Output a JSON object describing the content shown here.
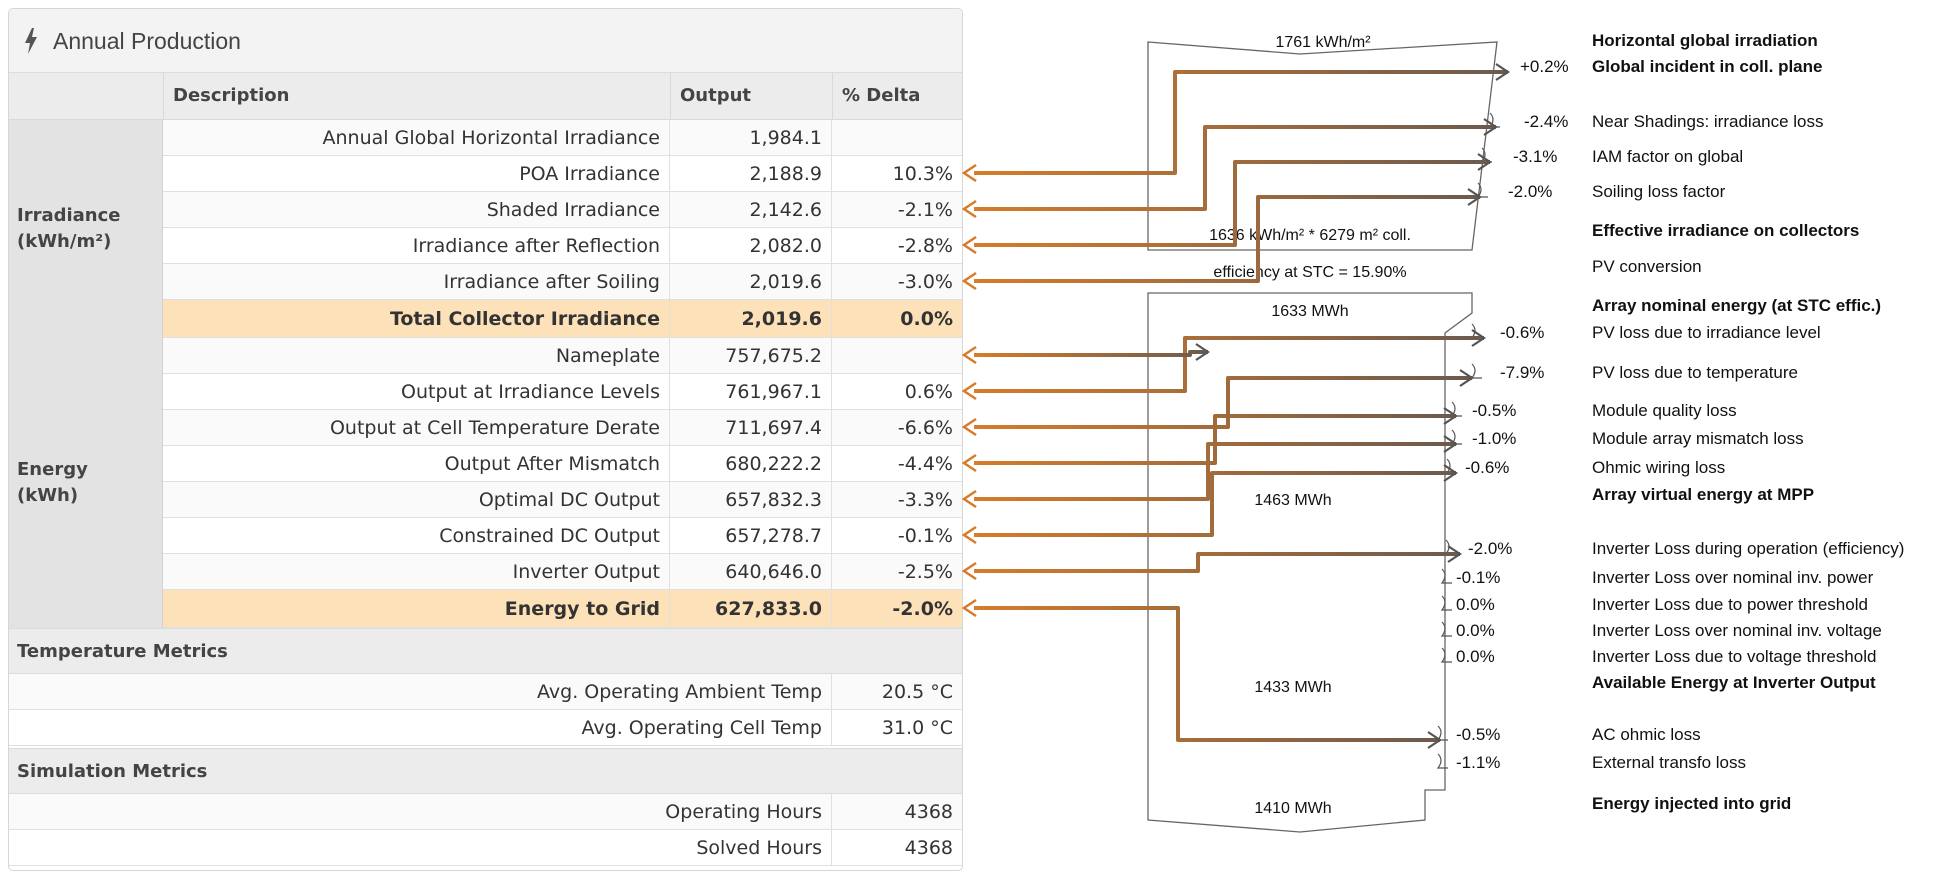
{
  "panel": {
    "title": "Annual Production"
  },
  "icons": {
    "title_icon": "lightning-bolt-icon",
    "arrow_icon": "left-arrow-icon"
  },
  "colors": {
    "accent_orange": "#d67c2a",
    "total_row_bg": "#fde1b8",
    "arrow_brown": "#6b5a4e"
  },
  "table": {
    "headers": {
      "description": "Description",
      "output": "Output",
      "delta": "% Delta"
    },
    "groups": [
      {
        "category": "Irradiance\n(kWh/m²)",
        "rows": [
          {
            "description": "Annual Global Horizontal Irradiance",
            "output": "1,984.1",
            "delta": "",
            "total": false
          },
          {
            "description": "POA Irradiance",
            "output": "2,188.9",
            "delta": "10.3%",
            "total": false
          },
          {
            "description": "Shaded Irradiance",
            "output": "2,142.6",
            "delta": "-2.1%",
            "total": false
          },
          {
            "description": "Irradiance after Reflection",
            "output": "2,082.0",
            "delta": "-2.8%",
            "total": false
          },
          {
            "description": "Irradiance after Soiling",
            "output": "2,019.6",
            "delta": "-3.0%",
            "total": false
          },
          {
            "description": "Total Collector Irradiance",
            "output": "2,019.6",
            "delta": "0.0%",
            "total": true
          }
        ]
      },
      {
        "category": "Energy\n(kWh)",
        "rows": [
          {
            "description": "Nameplate",
            "output": "757,675.2",
            "delta": "",
            "total": false
          },
          {
            "description": "Output at Irradiance Levels",
            "output": "761,967.1",
            "delta": "0.6%",
            "total": false
          },
          {
            "description": "Output at Cell Temperature Derate",
            "output": "711,697.4",
            "delta": "-6.6%",
            "total": false
          },
          {
            "description": "Output After Mismatch",
            "output": "680,222.2",
            "delta": "-4.4%",
            "total": false
          },
          {
            "description": "Optimal DC Output",
            "output": "657,832.3",
            "delta": "-3.3%",
            "total": false
          },
          {
            "description": "Constrained DC Output",
            "output": "657,278.7",
            "delta": "-0.1%",
            "total": false
          },
          {
            "description": "Inverter Output",
            "output": "640,646.0",
            "delta": "-2.5%",
            "total": false
          },
          {
            "description": "Energy to Grid",
            "output": "627,833.0",
            "delta": "-2.0%",
            "total": true
          }
        ]
      }
    ],
    "temperature_metrics": {
      "title": "Temperature Metrics",
      "rows": [
        {
          "label": "Avg. Operating Ambient Temp",
          "value": "20.5 °C"
        },
        {
          "label": "Avg. Operating Cell Temp",
          "value": "31.0 °C"
        }
      ]
    },
    "simulation_metrics": {
      "title": "Simulation Metrics",
      "rows": [
        {
          "label": "Operating Hours",
          "value": "4368"
        },
        {
          "label": "Solved Hours",
          "value": "4368"
        }
      ]
    }
  },
  "loss_diagram": {
    "box_texts": {
      "ghi": "1761 kWh/m²",
      "collector": "1636 kWh/m² * 6279 m² coll.",
      "efficiency": "efficiency at STC = 15.90%",
      "nominal": "1633 MWh",
      "mpp": "1463 MWh",
      "inverter": "1433 MWh",
      "grid": "1410 MWh"
    },
    "steps": [
      {
        "pct": "",
        "label": "Horizontal global irradiation",
        "bold": true
      },
      {
        "pct": "+0.2%",
        "label": "Global incident in coll. plane",
        "bold": true
      },
      {
        "pct": "-2.4%",
        "label": "Near Shadings: irradiance loss",
        "bold": false
      },
      {
        "pct": "-3.1%",
        "label": "IAM factor on global",
        "bold": false
      },
      {
        "pct": "-2.0%",
        "label": "Soiling loss factor",
        "bold": false
      },
      {
        "pct": "",
        "label": "Effective irradiance on collectors",
        "bold": true
      },
      {
        "pct": "",
        "label": "PV conversion",
        "bold": false
      },
      {
        "pct": "",
        "label": "Array nominal energy (at STC effic.)",
        "bold": true
      },
      {
        "pct": "-0.6%",
        "label": "PV loss due to irradiance level",
        "bold": false
      },
      {
        "pct": "-7.9%",
        "label": "PV loss due to temperature",
        "bold": false
      },
      {
        "pct": "-0.5%",
        "label": "Module quality loss",
        "bold": false
      },
      {
        "pct": "-1.0%",
        "label": "Module array mismatch loss",
        "bold": false
      },
      {
        "pct": "-0.6%",
        "label": "Ohmic wiring loss",
        "bold": false
      },
      {
        "pct": "",
        "label": "Array virtual energy at MPP",
        "bold": true
      },
      {
        "pct": "-2.0%",
        "label": "Inverter Loss during operation (efficiency)",
        "bold": false
      },
      {
        "pct": "-0.1%",
        "label": "Inverter Loss over nominal inv. power",
        "bold": false
      },
      {
        "pct": "0.0%",
        "label": "Inverter Loss due to power threshold",
        "bold": false
      },
      {
        "pct": "0.0%",
        "label": "Inverter Loss over nominal inv. voltage",
        "bold": false
      },
      {
        "pct": "0.0%",
        "label": "Inverter Loss due to voltage threshold",
        "bold": false
      },
      {
        "pct": "",
        "label": "Available Energy at Inverter Output",
        "bold": true
      },
      {
        "pct": "-0.5%",
        "label": "AC ohmic loss",
        "bold": false
      },
      {
        "pct": "-1.1%",
        "label": "External transfo loss",
        "bold": false
      },
      {
        "pct": "",
        "label": "Energy injected into grid",
        "bold": true
      }
    ]
  }
}
